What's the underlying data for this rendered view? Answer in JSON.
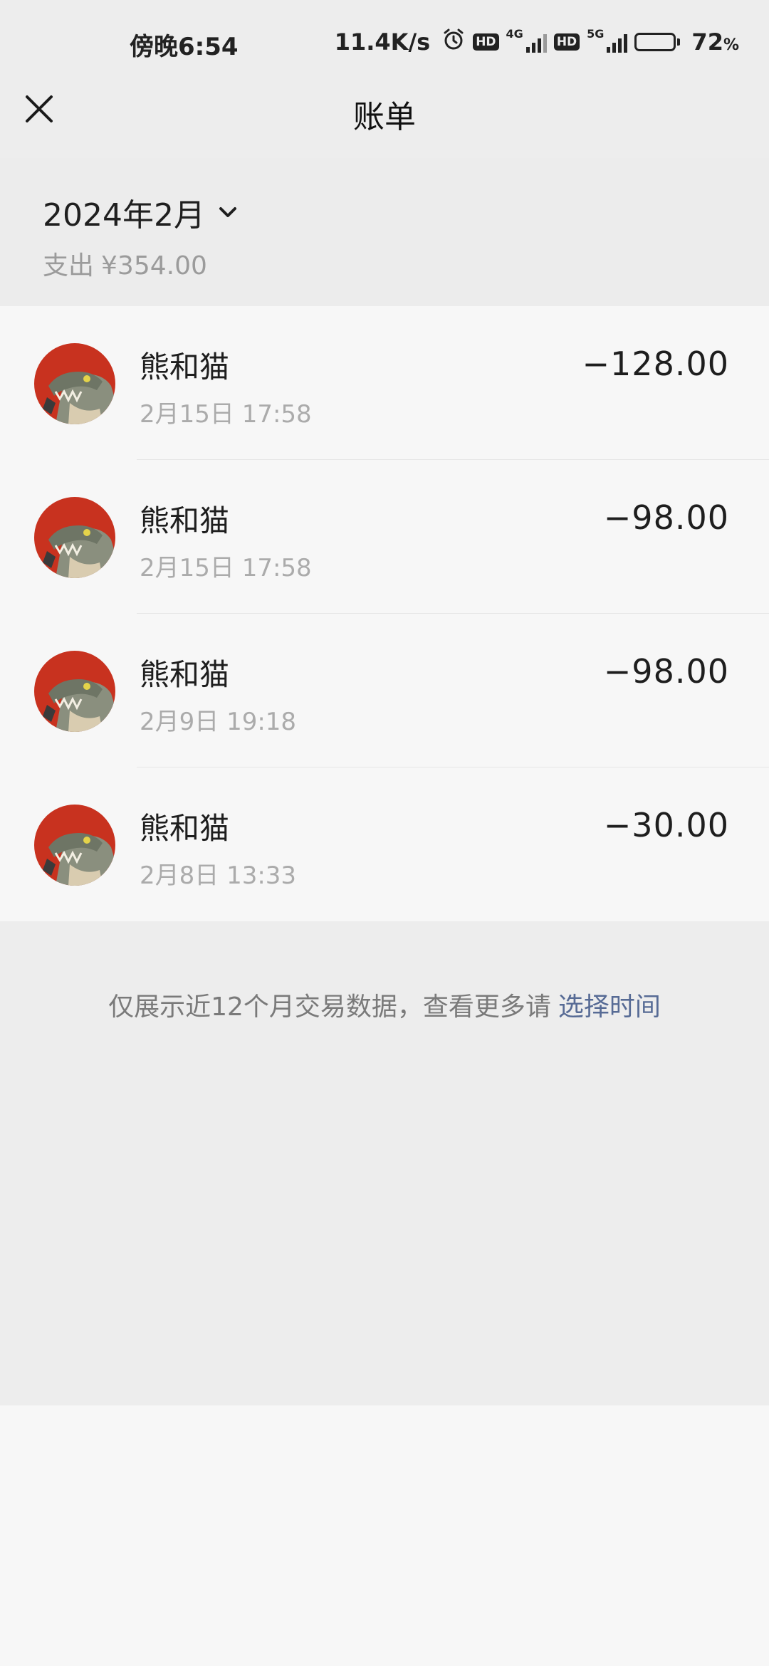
{
  "status_bar": {
    "time": "傍晚6:54",
    "net_speed": "11.4K/s",
    "hd1": "HD",
    "gen1": "4G",
    "hd2": "HD",
    "gen2": "5G",
    "battery_level": 72,
    "battery_value": "72",
    "battery_pct": "%"
  },
  "header": {
    "title": "账单",
    "close_icon": "close-icon"
  },
  "summary": {
    "month": "2024年2月",
    "spend_label": "支出",
    "spend_amount": "¥354.00"
  },
  "transactions": [
    {
      "name": "熊和猫",
      "time": "2月15日 17:58",
      "amount": "−128.00"
    },
    {
      "name": "熊和猫",
      "time": "2月15日 17:58",
      "amount": "−98.00"
    },
    {
      "name": "熊和猫",
      "time": "2月9日 19:18",
      "amount": "−98.00"
    },
    {
      "name": "熊和猫",
      "time": "2月8日 13:33",
      "amount": "−30.00"
    }
  ],
  "footer": {
    "note": "仅展示近12个月交易数据，查看更多请",
    "link": "选择时间"
  },
  "colors": {
    "link": "#576b95",
    "avatar_bg": "#c8321f"
  }
}
